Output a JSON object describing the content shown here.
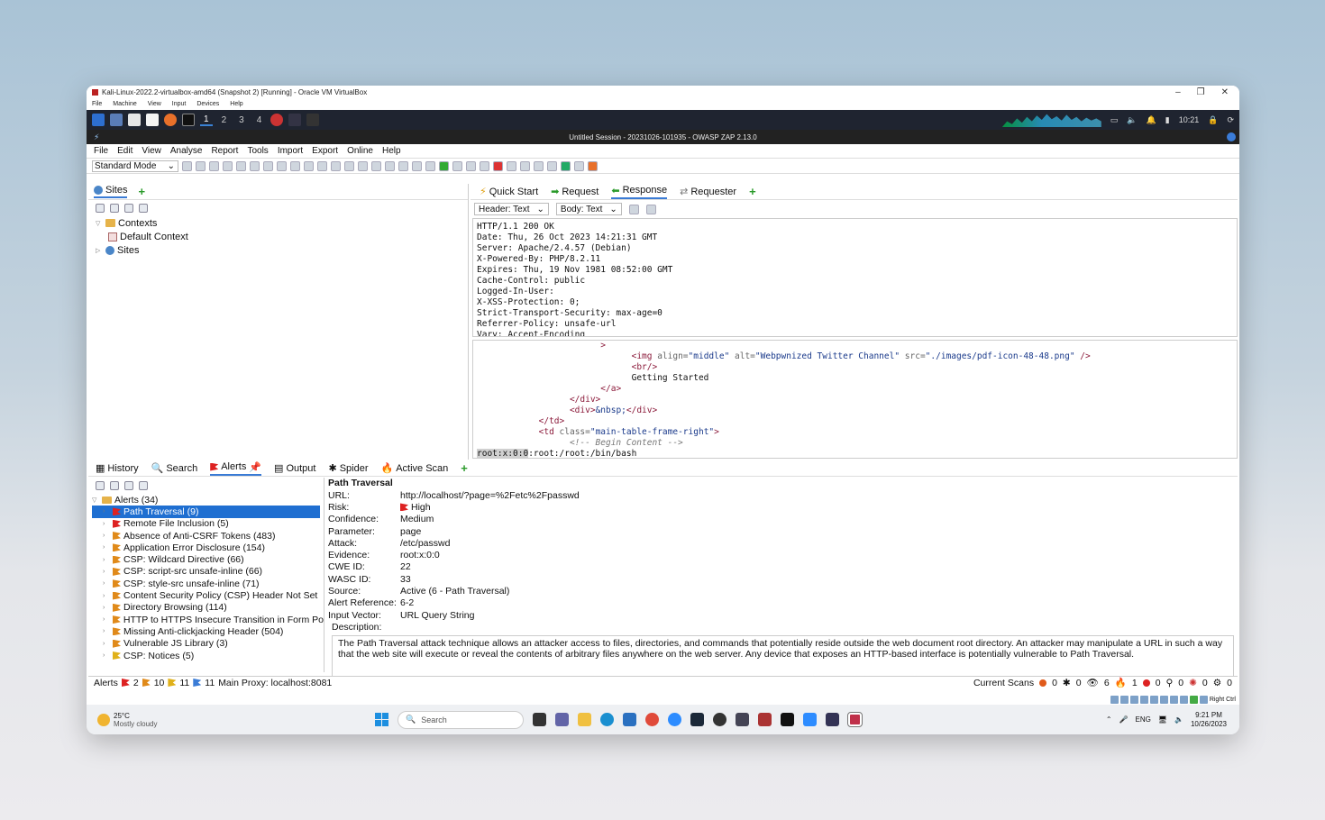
{
  "vbox": {
    "title": "Kali-Linux-2022.2-virtualbox-amd64 (Snapshot 2) [Running] - Oracle VM VirtualBox",
    "menu": [
      "File",
      "Machine",
      "View",
      "Input",
      "Devices",
      "Help"
    ]
  },
  "kali": {
    "workspaces": [
      "1",
      "2",
      "3",
      "4"
    ],
    "clock": "10:21"
  },
  "zap": {
    "window_title": "Untitled Session - 20231026-101935 - OWASP ZAP 2.13.0",
    "menu": [
      "File",
      "Edit",
      "View",
      "Analyse",
      "Report",
      "Tools",
      "Import",
      "Export",
      "Online",
      "Help"
    ],
    "mode": "Standard Mode"
  },
  "sites": {
    "tab_label": "Sites",
    "tree": {
      "contexts": "Contexts",
      "default_context": "Default Context",
      "sites": "Sites"
    }
  },
  "request_tabs": {
    "quick_start": "Quick Start",
    "request": "Request",
    "response": "Response",
    "requester": "Requester"
  },
  "view": {
    "header_select": "Header: Text",
    "body_select": "Body: Text"
  },
  "response_headers": [
    "HTTP/1.1 200 OK",
    "Date: Thu, 26 Oct 2023 14:21:31 GMT",
    "Server: Apache/2.4.57 (Debian)",
    "X-Powered-By: PHP/8.2.11",
    "Expires: Thu, 19 Nov 1981 08:52:00 GMT",
    "Cache-Control: public",
    "Logged-In-User:",
    "X-XSS-Protection: 0;",
    "Strict-Transport-Security: max-age=0",
    "Referrer-Policy: unsafe-url",
    "Vary: Accept-Encoding"
  ],
  "response_body": {
    "line1": ">",
    "img_tag": "<img",
    "img_attr1": " align=",
    "img_val1": "\"middle\"",
    "img_attr2": " alt=",
    "img_val2": "\"Webpwnized Twitter Channel\"",
    "img_attr3": " src=",
    "img_val3": "\"./images/pdf-icon-48-48.png\"",
    "img_close": " />",
    "br": "<br/>",
    "getting_started": "Getting Started",
    "a_close": "</a>",
    "div_close": "</div>",
    "div_open": "<div>",
    "nbsp": "&nbsp;",
    "div_close2": "</div>",
    "td_close": "</td>",
    "td_open": "<td",
    "td_attr": " class=",
    "td_val": "\"main-table-frame-right\"",
    "td_end": ">",
    "comment": "<!-- Begin Content -->",
    "evidence_highlight": "root:x:0:0",
    "evidence_rest": ":root:/root:/bin/bash"
  },
  "bottom_tabs": {
    "history": "History",
    "search": "Search",
    "alerts": "Alerts",
    "output": "Output",
    "spider": "Spider",
    "active_scan": "Active Scan"
  },
  "alerts": {
    "root": "Alerts (34)",
    "items": [
      {
        "label": "Path Traversal (9)",
        "risk": "high"
      },
      {
        "label": "Remote File Inclusion (5)",
        "risk": "high"
      },
      {
        "label": "Absence of Anti-CSRF Tokens (483)",
        "risk": "med"
      },
      {
        "label": "Application Error Disclosure (154)",
        "risk": "med"
      },
      {
        "label": "CSP: Wildcard Directive (66)",
        "risk": "med"
      },
      {
        "label": "CSP: script-src unsafe-inline (66)",
        "risk": "med"
      },
      {
        "label": "CSP: style-src unsafe-inline (71)",
        "risk": "med"
      },
      {
        "label": "Content Security Policy (CSP) Header Not Set",
        "risk": "med"
      },
      {
        "label": "Directory Browsing (114)",
        "risk": "med"
      },
      {
        "label": "HTTP to HTTPS Insecure Transition in Form Po",
        "risk": "med"
      },
      {
        "label": "Missing Anti-clickjacking Header (504)",
        "risk": "med"
      },
      {
        "label": "Vulnerable JS Library (3)",
        "risk": "med"
      },
      {
        "label": "CSP: Notices (5)",
        "risk": "low"
      }
    ]
  },
  "detail": {
    "title": "Path Traversal",
    "fields": [
      {
        "k": "URL:",
        "v": "http://localhost/?page=%2Fetc%2Fpasswd"
      },
      {
        "k": "Risk:",
        "v": "High"
      },
      {
        "k": "Confidence:",
        "v": "Medium"
      },
      {
        "k": "Parameter:",
        "v": "page"
      },
      {
        "k": "Attack:",
        "v": "/etc/passwd"
      },
      {
        "k": "Evidence:",
        "v": "root:x:0:0"
      },
      {
        "k": "CWE ID:",
        "v": "22"
      },
      {
        "k": "WASC ID:",
        "v": "33"
      },
      {
        "k": "Source:",
        "v": "Active (6 - Path Traversal)"
      },
      {
        "k": "Alert Reference:",
        "v": "6-2"
      },
      {
        "k": "Input Vector:",
        "v": "URL Query String"
      }
    ],
    "description_label": "Description:",
    "description": "The Path Traversal attack technique allows an attacker access to files, directories, and commands that potentially reside outside the web document root directory. An attacker may manipulate a URL in such a way that the web site will execute or reveal the contents of arbitrary files anywhere on the web server. Any device that exposes an HTTP-based interface is potentially vulnerable to Path Traversal."
  },
  "status": {
    "alerts_label": "Alerts",
    "high": "2",
    "medium": "10",
    "low": "11",
    "info": "11",
    "proxy": "Main Proxy: localhost:8081",
    "current_scans": "Current Scans",
    "scan_counts": [
      "0",
      "0",
      "6",
      "1",
      "0",
      "0",
      "0",
      "0"
    ]
  },
  "vb_status": {
    "host_key": "Right Ctrl"
  },
  "taskbar": {
    "temp": "25°C",
    "weather": "Mostly cloudy",
    "search": "Search",
    "lang": "ENG",
    "time": "9:21 PM",
    "date": "10/26/2023"
  }
}
